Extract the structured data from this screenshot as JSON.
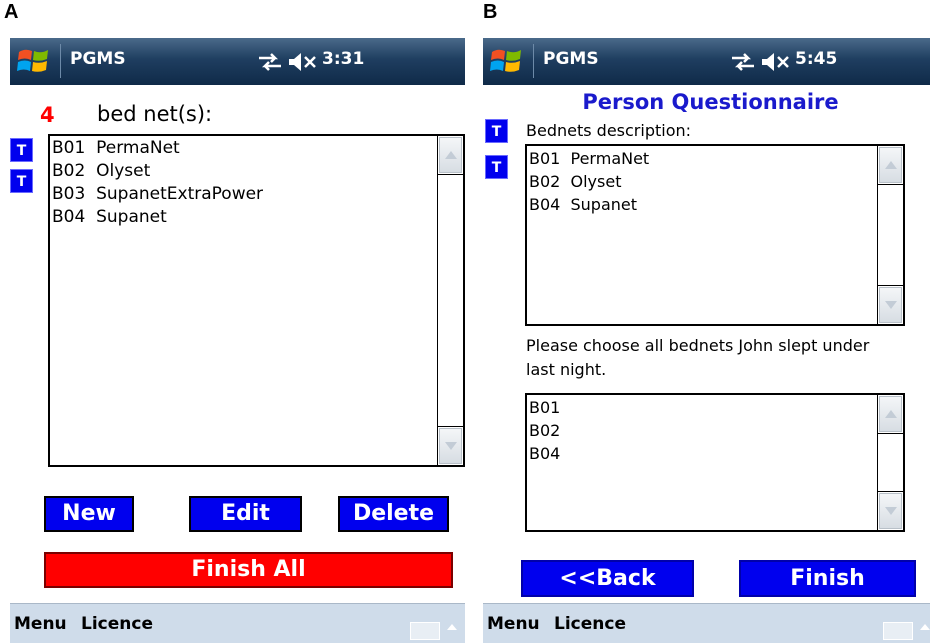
{
  "labels": {
    "a": "A",
    "b": "B"
  },
  "colors": {
    "button_blue": "#0000ee",
    "finish_all_red": "#ff0000",
    "count_red": "#ff0000",
    "heading_blue": "#1a1acc",
    "titlebar": "#1f3e60",
    "menubar": "#cfdcea"
  },
  "screen_a": {
    "titlebar": {
      "app": "PGMS",
      "time": "3:31",
      "icons": [
        "windows-logo-icon",
        "connectivity-icon",
        "speaker-muted-icon"
      ]
    },
    "count": "4",
    "count_label": "bed net(s):",
    "t_buttons": [
      "T",
      "T"
    ],
    "list_items": [
      "B01  PermaNet",
      "B02  Olyset",
      "B03  SupanetExtraPower",
      "B04  Supanet"
    ],
    "buttons": {
      "new": "New",
      "edit": "Edit",
      "delete": "Delete",
      "finish_all": "Finish All"
    },
    "menu": {
      "left": "Menu",
      "right": "Licence",
      "icons": [
        "keyboard-icon",
        "caret-up-icon"
      ]
    }
  },
  "screen_b": {
    "titlebar": {
      "app": "PGMS",
      "time": "5:45",
      "icons": [
        "windows-logo-icon",
        "connectivity-icon",
        "speaker-muted-icon"
      ]
    },
    "title": "Person Questionnaire",
    "t_buttons": [
      "T",
      "T"
    ],
    "description_label": "Bednets description:",
    "description_items": [
      "B01  PermaNet",
      "B02  Olyset",
      "B04  Supanet"
    ],
    "question_line1": "Please choose all bednets John slept under",
    "question_line2": "last night.",
    "choice_items": [
      "B01",
      "B02",
      "B04"
    ],
    "buttons": {
      "back": "<<Back",
      "finish": "Finish"
    },
    "menu": {
      "left": "Menu",
      "right": "Licence",
      "icons": [
        "keyboard-icon",
        "caret-up-icon"
      ]
    }
  }
}
